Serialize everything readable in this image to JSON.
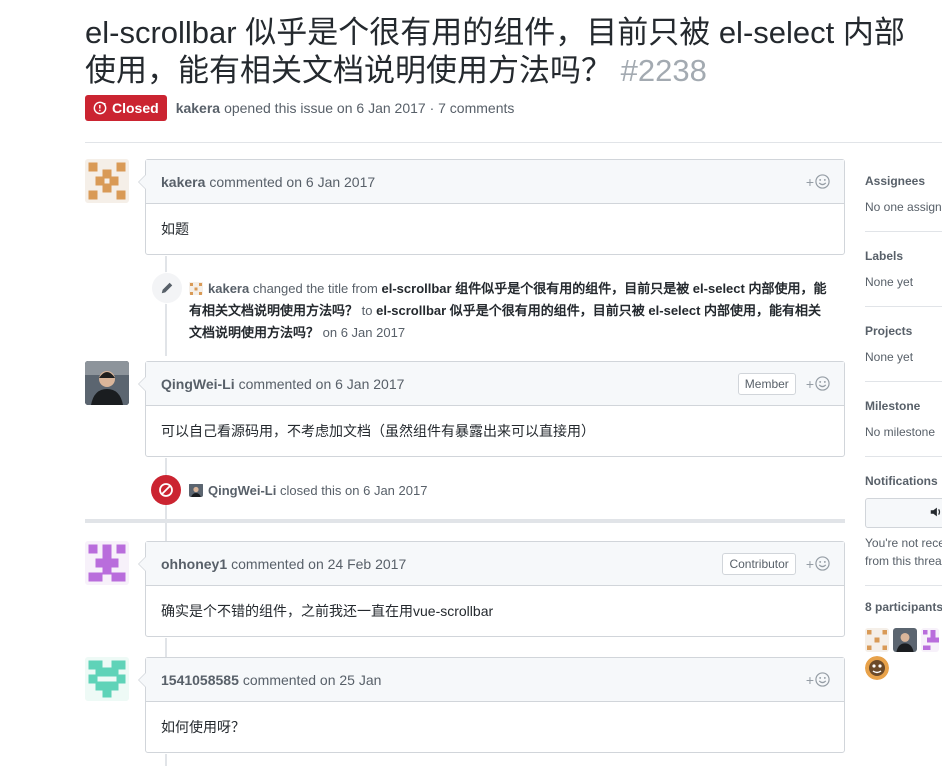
{
  "issue": {
    "title": "el-scrollbar 似乎是个很有用的组件，目前只被 el-select 内部使用，能有相关文档说明使用方法吗？",
    "number": "#2238",
    "status": "Closed",
    "author": "kakera",
    "opened_text": "opened this issue on 6 Jan 2017 · 7 comments"
  },
  "timeline": {
    "c1": {
      "author": "kakera",
      "meta": "commented on 6 Jan 2017",
      "body": "如题"
    },
    "rename": {
      "author": "kakera",
      "t1": "changed the title from",
      "old_title": "el-scrollbar 组件似乎是个很有用的组件，目前只是被 el-select 内部使用，能有相关文档说明使用方法吗？",
      "t2": "to",
      "new_title": "el-scrollbar 似乎是个很有用的组件，目前只被 el-select 内部使用，能有相关文档说明使用方法吗？",
      "t3": "on 6 Jan 2017"
    },
    "c2": {
      "author": "QingWei-Li",
      "meta": "commented on 6 Jan 2017",
      "role": "Member",
      "body": "可以自己看源码用，不考虑加文档（虽然组件有暴露出来可以直接用）"
    },
    "closed": {
      "author": "QingWei-Li",
      "text": "closed this on 6 Jan 2017"
    },
    "c3": {
      "author": "ohhoney1",
      "meta": "commented on 24 Feb 2017",
      "role": "Contributor",
      "body": "确实是个不错的组件，之前我还一直在用vue-scrollbar"
    },
    "c4": {
      "author": "1541058585",
      "meta": "commented on 25 Jan",
      "body": "如何使用呀？"
    }
  },
  "sidebar": {
    "assignees": {
      "label": "Assignees",
      "value": "No one assigne"
    },
    "labels": {
      "label": "Labels",
      "value": "None yet"
    },
    "projects": {
      "label": "Projects",
      "value": "None yet"
    },
    "milestone": {
      "label": "Milestone",
      "value": "No milestone"
    },
    "notifications": {
      "label": "Notifications",
      "note1": "You're not rece",
      "note2": "from this threa"
    },
    "participants": {
      "label": "8 participants"
    }
  },
  "colors": {
    "closed": "#cb2431",
    "accent_orange": "#e0883a",
    "accent_purple": "#b265dc",
    "accent_teal": "#5fd3b8"
  },
  "icons": [
    "closed-issue-icon",
    "smiley-icon",
    "pencil-icon",
    "circle-slash-icon",
    "speaker-icon"
  ]
}
